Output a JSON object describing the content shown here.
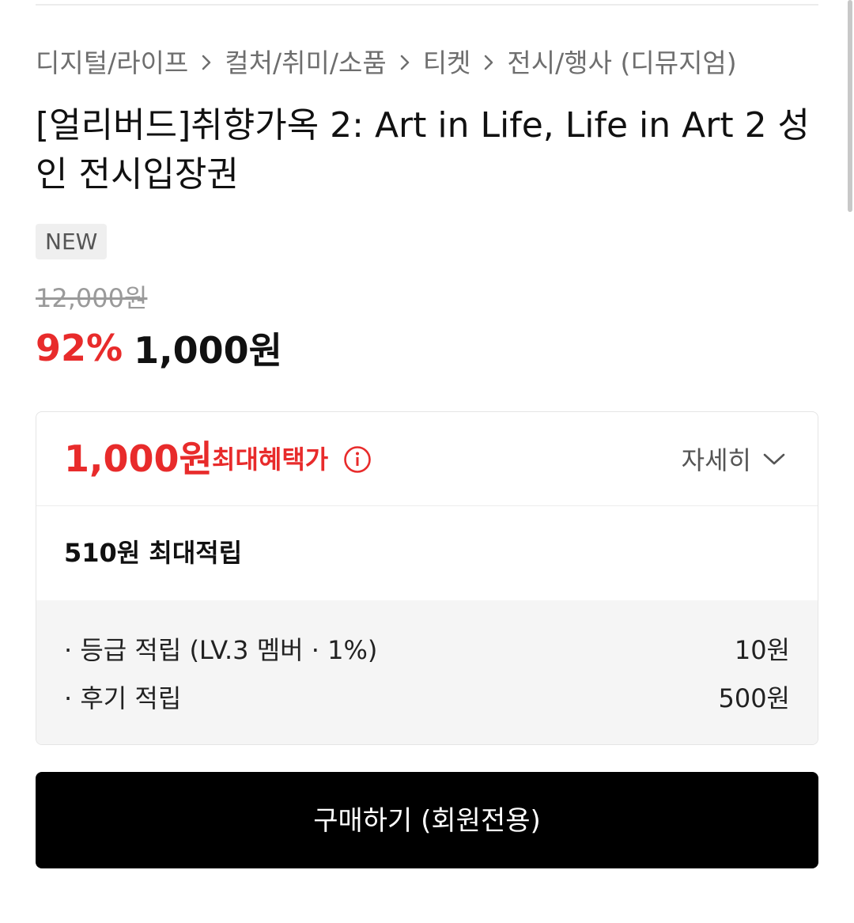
{
  "breadcrumb": {
    "items": [
      "디지털/라이프",
      "컬처/취미/소품",
      "티켓",
      "전시/행사 (디뮤지엄)"
    ],
    "separator_icon": "chevron-right-icon"
  },
  "product": {
    "title": "[얼리버드]취향가옥 2: Art in Life, Life in Art 2 성인 전시입장권",
    "badge": "NEW",
    "original_price": "12,000원",
    "discount_rate": "92%",
    "sale_price": "1,000원"
  },
  "benefit": {
    "max_price": "1,000원",
    "max_price_label": "최대혜택가",
    "info_icon": "info-circle-icon",
    "detail_label": "자세히",
    "detail_icon": "chevron-down-icon",
    "points_total": "510원 최대적립",
    "points": [
      {
        "label": "· 등급 적립 (LV.3 멤버 · 1%)",
        "value": "10원"
      },
      {
        "label": "· 후기 적립",
        "value": "500원"
      }
    ]
  },
  "actions": {
    "buy_label": "구매하기 (회원전용)"
  },
  "colors": {
    "accent_red": "#e82b2b",
    "button_bg": "#000000",
    "detail_bg": "#f5f5f5"
  }
}
